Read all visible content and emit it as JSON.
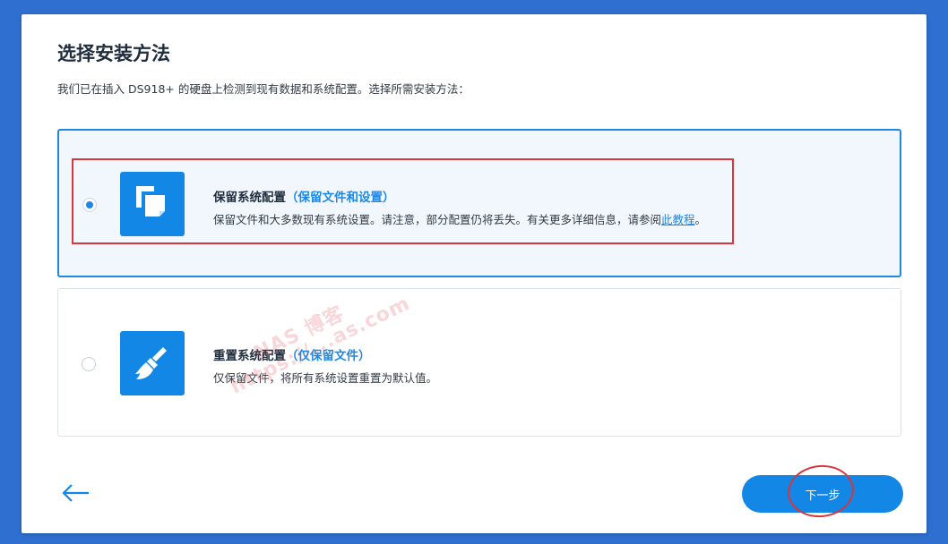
{
  "dialog": {
    "title": "选择安装方法",
    "subtitle": "我们已在插入 DS918+ 的硬盘上检测到现有数据和系统配置。选择所需安装方法："
  },
  "options": [
    {
      "title": "保留系统配置",
      "title_highlight": "（保留文件和设置）",
      "desc": "保留文件和大多数现有系统设置。请注意，部分配置仍将丢失。有关更多详细信息，请参阅",
      "link": "此教程",
      "desc_end": "。",
      "icon": "copy-files-icon",
      "selected": true
    },
    {
      "title": "重置系统配置",
      "title_highlight": "（仅保留文件）",
      "desc": "仅保留文件，将所有系统设置重置为默认值。",
      "icon": "broom-icon",
      "selected": false
    }
  ],
  "footer": {
    "back_icon": "arrow-left-icon",
    "next_label": "下一步"
  },
  "watermark": {
    "line1": "NAS 博客",
    "line2": "https://...as.com"
  },
  "colors": {
    "accent": "#1287e6",
    "annotation_red": "#d9353a",
    "page_background": "#2e6fd0"
  }
}
